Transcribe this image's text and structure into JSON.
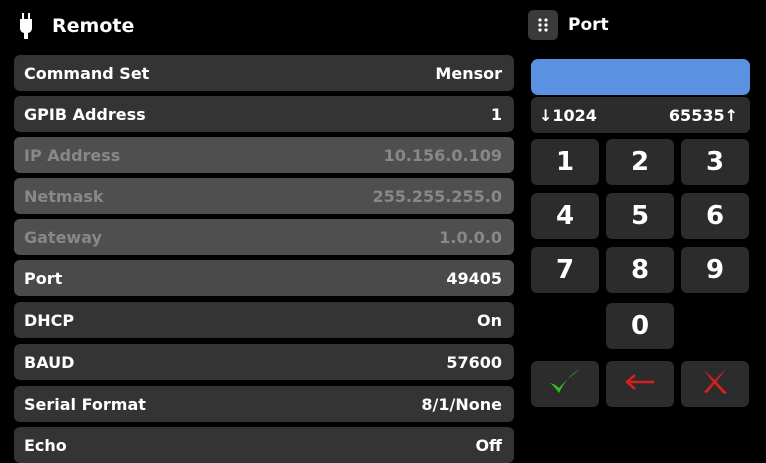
{
  "header": {
    "title": "Remote",
    "icon": "plug-icon"
  },
  "settings": [
    {
      "label": "Command Set",
      "value": "Mensor",
      "state": "normal"
    },
    {
      "label": "GPIB Address",
      "value": "1",
      "state": "normal"
    },
    {
      "label": "IP Address",
      "value": "10.156.0.109",
      "state": "disabled"
    },
    {
      "label": "Netmask",
      "value": "255.255.255.0",
      "state": "disabled"
    },
    {
      "label": "Gateway",
      "value": "1.0.0.0",
      "state": "disabled"
    },
    {
      "label": "Port",
      "value": "49405",
      "state": "selected"
    },
    {
      "label": "DHCP",
      "value": "On",
      "state": "normal"
    },
    {
      "label": "BAUD",
      "value": "57600",
      "state": "normal"
    },
    {
      "label": "Serial Format",
      "value": "8/1/None",
      "state": "normal"
    },
    {
      "label": "Echo",
      "value": "Off",
      "state": "normal"
    }
  ],
  "keypad": {
    "title": "Port",
    "menu_icon": "grid-menu-icon",
    "entry_value": "",
    "min": "↓1024",
    "max": "65535↑",
    "keys": [
      "1",
      "2",
      "3",
      "4",
      "5",
      "6",
      "7",
      "8",
      "9",
      "0"
    ],
    "confirm_icon": "checkmark-icon",
    "backspace_icon": "left-arrow-icon",
    "cancel_icon": "x-icon"
  },
  "colors": {
    "background": "#000000",
    "row": "#343434",
    "row_disabled": "#4f4f4f",
    "entry": "#5a91e0",
    "confirm": "#33bb22",
    "cancel": "#d42020"
  }
}
